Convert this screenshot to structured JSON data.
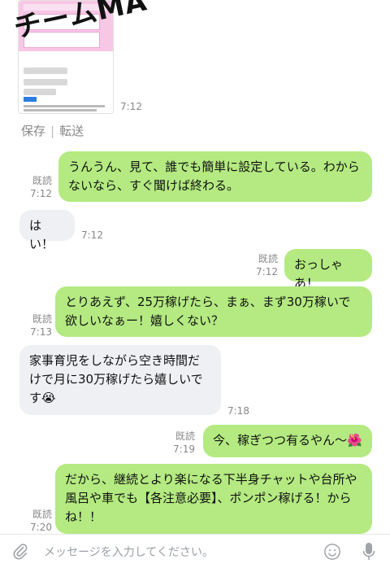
{
  "watermark": "チームMA",
  "image_message": {
    "time": "7:12"
  },
  "actions": {
    "save_label": "保存",
    "forward_label": "転送"
  },
  "messages": [
    {
      "side": "right",
      "read": "既読",
      "time": "7:12",
      "text": "うんうん、見て、誰でも簡単に設定している。わからないなら、すぐ聞けば終わる。"
    },
    {
      "side": "left",
      "time": "7:12",
      "text": "はい！"
    },
    {
      "side": "right",
      "read": "既読",
      "time": "7:12",
      "text": "おっしゃあ！"
    },
    {
      "side": "right",
      "read": "既読",
      "time": "7:13",
      "text": "とりあえず、25万稼げたら、まぁ、まず30万稼いで欲しいなぁー！嬉しくない？"
    },
    {
      "side": "left",
      "time": "7:18",
      "text": "家事育児をしながら空き時間だけで月に30万稼げたら嬉しいです😭"
    },
    {
      "side": "right",
      "read": "既読",
      "time": "7:19",
      "text": "今、稼ぎつつ有るやん〜🌺"
    },
    {
      "side": "right",
      "read": "既読",
      "time": "7:20",
      "text": "だから、継続とより楽になる下半身チャットや台所や風呂や車でも【各注意必要】、ポンポン稼げる！からね！！"
    }
  ],
  "composer": {
    "placeholder": "メッセージを入力してください。"
  },
  "colors": {
    "sent_bubble": "#b4ea81",
    "received_bubble": "#eef0f4"
  },
  "icons": [
    "paperclip-icon",
    "smiley-icon",
    "microphone-icon"
  ]
}
